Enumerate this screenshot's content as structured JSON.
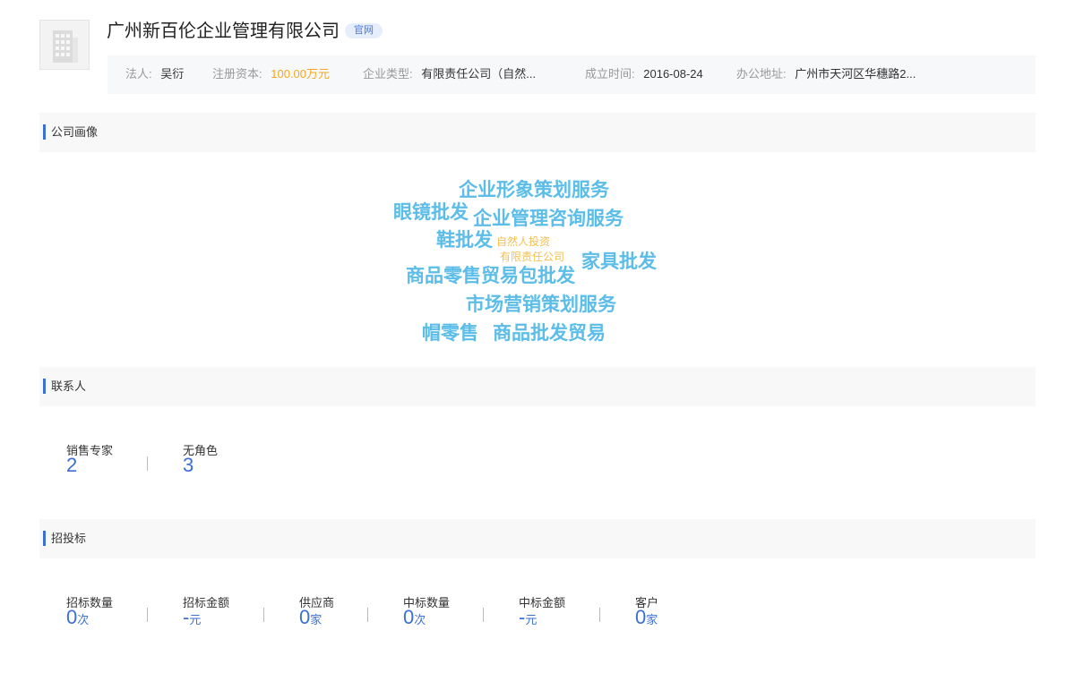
{
  "company": {
    "name": "广州新百伦企业管理有限公司",
    "badge": "官网",
    "logo_icon": "building-icon"
  },
  "info": {
    "legal_person_label": "法人:",
    "legal_person": "吴衍",
    "capital_label": "注册资本:",
    "capital": "100.00万元",
    "type_label": "企业类型:",
    "type": "有限责任公司（自然...",
    "founded_label": "成立时间:",
    "founded": "2016-08-24",
    "address_label": "办公地址:",
    "address": "广州市天河区华穗路2..."
  },
  "sections": {
    "portrait": "公司画像",
    "contacts": "联系人",
    "bidding": "招投标"
  },
  "word_cloud": [
    "企业形象策划服务",
    "眼镜批发",
    "企业管理咨询服务",
    "鞋批发",
    "自然人投资",
    "有限责任公司",
    "家具批发",
    "商品零售贸易包批发",
    "市场营销策划服务",
    "帽零售",
    "商品批发贸易"
  ],
  "contacts": [
    {
      "label": "销售专家",
      "value": "2"
    },
    {
      "label": "无角色",
      "value": "3"
    }
  ],
  "bidding": [
    {
      "label": "招标数量",
      "value": "0",
      "unit": "次"
    },
    {
      "label": "招标金额",
      "value": "-",
      "unit": "元"
    },
    {
      "label": "供应商",
      "value": "0",
      "unit": "家"
    },
    {
      "label": "中标数量",
      "value": "0",
      "unit": "次"
    },
    {
      "label": "中标金额",
      "value": "-",
      "unit": "元"
    },
    {
      "label": "客户",
      "value": "0",
      "unit": "家"
    }
  ],
  "colors": {
    "accent": "#3b6fd6",
    "cloud_blue": "#5bbde8",
    "cloud_yellow": "#f5c04f",
    "capital_orange": "#f5a623"
  }
}
